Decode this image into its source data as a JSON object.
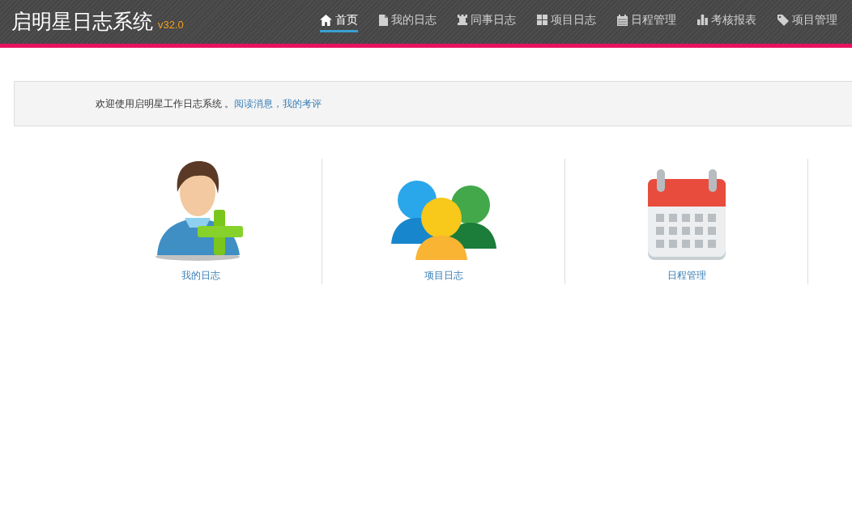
{
  "header": {
    "title": "启明星日志系统",
    "version": "v32.0"
  },
  "nav": [
    {
      "label": "首页",
      "kind": "home",
      "selected": true
    },
    {
      "label": "我的日志",
      "kind": "file",
      "selected": false
    },
    {
      "label": "同事日志",
      "kind": "rook",
      "selected": false
    },
    {
      "label": "项目日志",
      "kind": "grid",
      "selected": false
    },
    {
      "label": "日程管理",
      "kind": "calendar",
      "selected": false
    },
    {
      "label": "考核报表",
      "kind": "bars",
      "selected": false
    },
    {
      "label": "项目管理",
      "kind": "tag",
      "selected": false
    }
  ],
  "welcome": {
    "text": "欢迎使用启明星工作日志系统 。",
    "links": [
      "阅读消息",
      "我的考评"
    ],
    "separator": "，"
  },
  "tiles": [
    {
      "label": "我的日志",
      "kind": "user-add"
    },
    {
      "label": "项目日志",
      "kind": "group"
    },
    {
      "label": "日程管理",
      "kind": "calendar"
    }
  ]
}
